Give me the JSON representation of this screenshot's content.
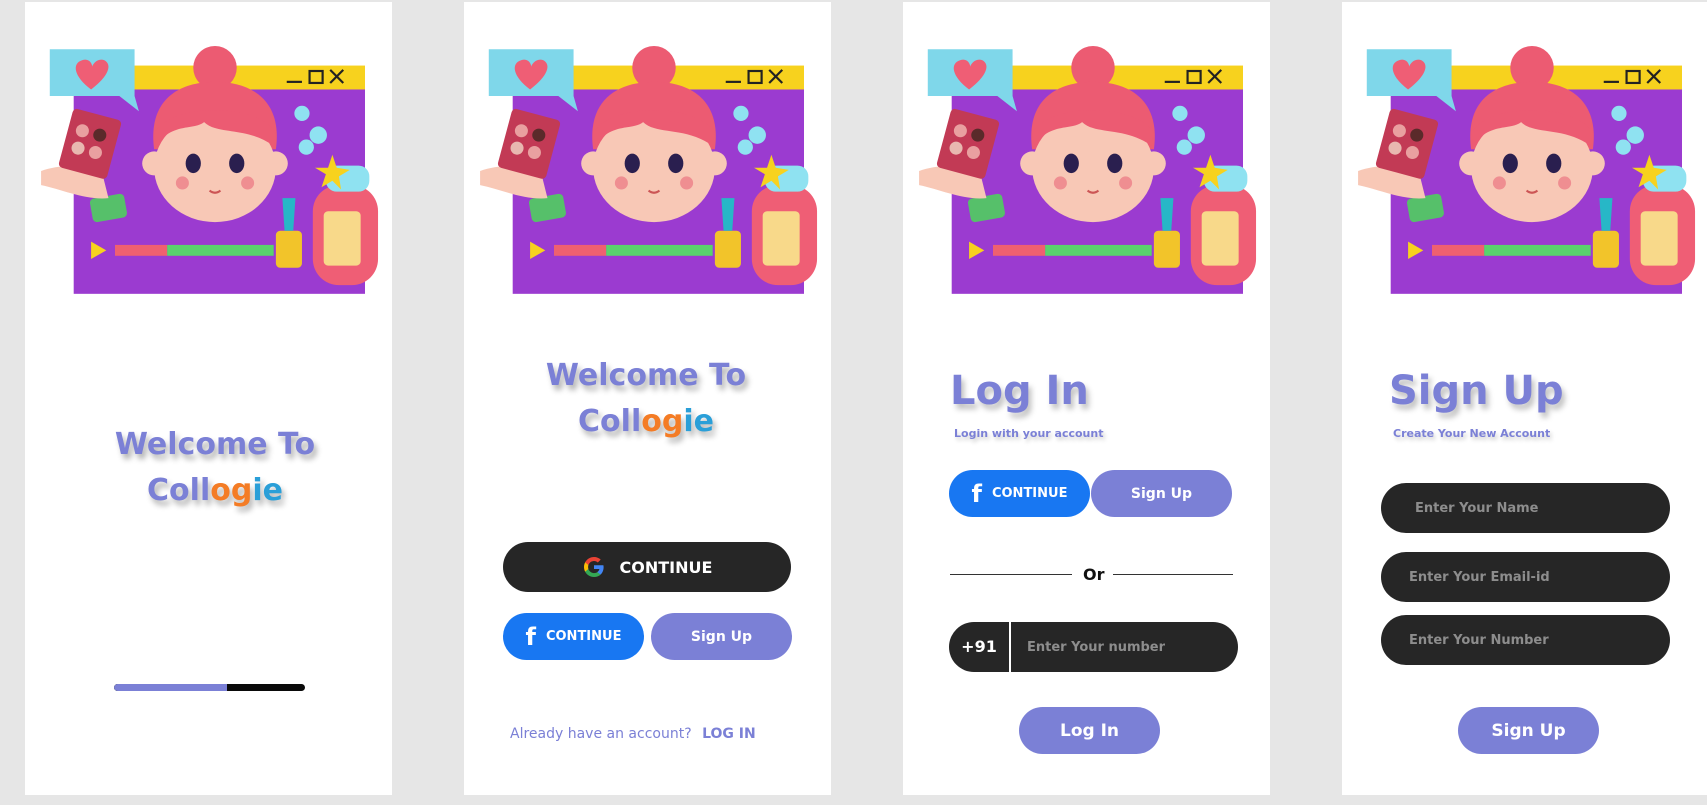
{
  "brand": {
    "p1": "Co",
    "p2": "ll",
    "p3": "og",
    "p4": "ie"
  },
  "screen1": {
    "welcome": "Welcome To",
    "progress": 0.59
  },
  "screen2": {
    "welcome": "Welcome To",
    "google_continue": "CONTINUE",
    "facebook_continue": "CONTINUE",
    "signup": "Sign Up",
    "already_text": "Already have an account?",
    "login_link": "LOG IN"
  },
  "screen3": {
    "title": "Log In",
    "subtitle": "Login with your account",
    "facebook_continue": "CONTINUE",
    "signup": "Sign Up",
    "or": "Or",
    "country_code": "+91",
    "number_placeholder": "Enter Your number",
    "login_button": "Log In"
  },
  "screen4": {
    "title": "Sign Up",
    "subtitle": "Create Your New  Account",
    "name_placeholder": "Enter Your Name",
    "email_placeholder": "Enter Your Email-id",
    "number_placeholder": "Enter Your Number",
    "signup_button": "Sign Up"
  },
  "colors": {
    "accent": "#7b80d6",
    "facebook": "#1877f2",
    "dark": "#262626",
    "orange": "#f47c25",
    "blue": "#2a9fd8"
  },
  "icons": [
    "facebook-icon",
    "google-icon",
    "illustration-girl-makeup"
  ]
}
